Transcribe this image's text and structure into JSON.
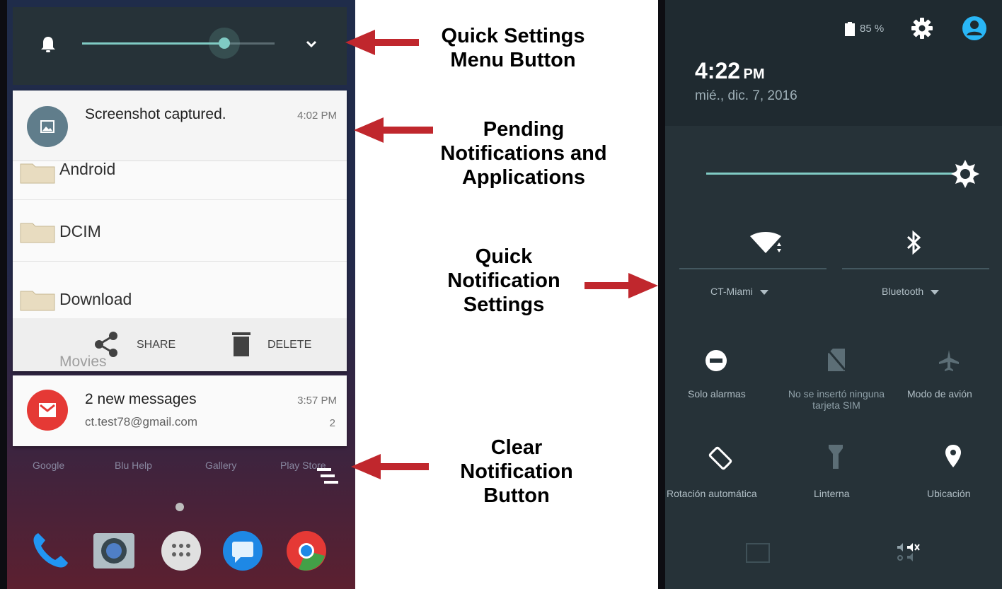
{
  "left_screen": {
    "quick_settings": {
      "brightness_level": 0.74
    },
    "notification": {
      "title": "Screenshot captured.",
      "time": "4:02 PM",
      "folders": [
        "Android",
        "DCIM",
        "Download"
      ],
      "next_folder_peek": "Movies",
      "share_label": "SHARE",
      "delete_label": "DELETE"
    },
    "mail_notification": {
      "title": "2 new messages",
      "account": "ct.test78@gmail.com",
      "time": "3:57 PM",
      "count": "2"
    },
    "home_apps": [
      "Google",
      "Blu Help",
      "Gallery",
      "Play Store"
    ],
    "dock_icons": [
      "phone-icon",
      "camera-icon",
      "app-drawer-icon",
      "messages-icon",
      "chrome-icon"
    ]
  },
  "annotations": {
    "quick_settings_menu": [
      "Quick Settings",
      "Menu Button"
    ],
    "pending_notifications": [
      "Pending",
      "Notifications and",
      "Applications"
    ],
    "quick_notification_settings": [
      "Quick",
      "Notification",
      "Settings"
    ],
    "clear_notification": [
      "Clear",
      "Notification",
      "Button"
    ],
    "arrow_color": "#c0272d"
  },
  "right_screen": {
    "battery": "85 %",
    "time": "4:22",
    "ampm": "PM",
    "date": "mié., dic. 7, 2016",
    "brightness_level": 1.0,
    "wifi_label": "CT-Miami",
    "bluetooth_label": "Bluetooth",
    "tiles": {
      "do_not_disturb": "Solo alarmas",
      "sim": [
        "No se insertó ninguna",
        "tarjeta SIM"
      ],
      "airplane": "Modo de avión",
      "rotation": "Rotación automática",
      "flashlight": "Linterna",
      "location": "Ubicación"
    },
    "accent_color": "#80cbc4",
    "user_color": "#29b6f6"
  }
}
